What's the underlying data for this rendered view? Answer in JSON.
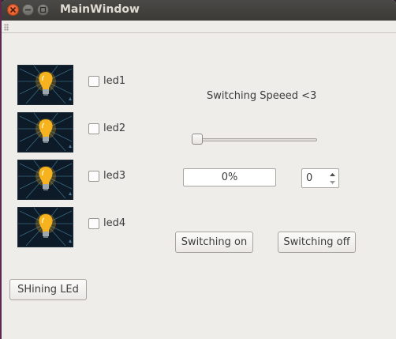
{
  "window": {
    "title": "MainWindow"
  },
  "leds": [
    {
      "label": "led1",
      "checked": false,
      "icon": "lightbulb-icon"
    },
    {
      "label": "led2",
      "checked": false,
      "icon": "lightbulb-icon"
    },
    {
      "label": "led3",
      "checked": false,
      "icon": "lightbulb-icon"
    },
    {
      "label": "led4",
      "checked": false,
      "icon": "lightbulb-icon"
    }
  ],
  "speed": {
    "label": "Switching Speeed <3",
    "slider_value": 0
  },
  "progress": {
    "text": "0%",
    "value": 0
  },
  "spinbox": {
    "value": "0"
  },
  "buttons": {
    "switching_on": "Switching on",
    "switching_off": "Switching off",
    "shining": "SHining LEd"
  },
  "colors": {
    "close_button": "#e2521d",
    "titlebar": "#3b3a37",
    "window_bg": "#efedea",
    "bulb_bg": "#0c1b27",
    "bulb_glow": "#f7b21f"
  }
}
